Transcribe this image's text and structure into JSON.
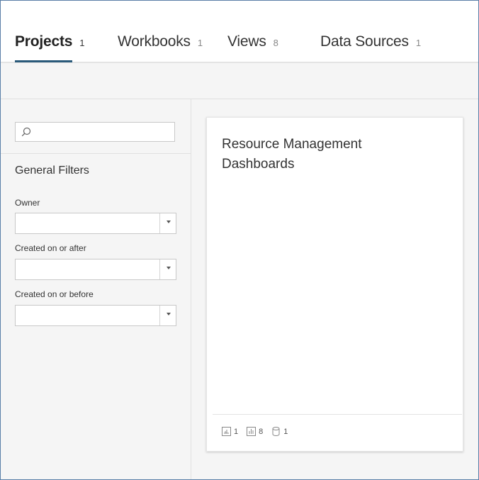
{
  "tabs": [
    {
      "label": "Projects",
      "count": "1"
    },
    {
      "label": "Workbooks",
      "count": "1"
    },
    {
      "label": "Views",
      "count": "8"
    },
    {
      "label": "Data Sources",
      "count": "1"
    }
  ],
  "filters": {
    "title": "General Filters",
    "search_value": "",
    "owner_label": "Owner",
    "owner_value": "",
    "after_label": "Created on or after",
    "after_value": "",
    "before_label": "Created on or before",
    "before_value": ""
  },
  "card": {
    "title": "Resource Management Dashboards",
    "workbooks": "1",
    "views": "8",
    "datasources": "1"
  },
  "icons": {
    "search": "search-icon",
    "workbook": "workbook-icon",
    "view": "view-icon",
    "datasource": "datasource-icon",
    "dropdown": "chevron-down-icon"
  },
  "colors": {
    "active_tab_underline": "#2a5a7a",
    "frame_border": "#5a7fa8"
  }
}
